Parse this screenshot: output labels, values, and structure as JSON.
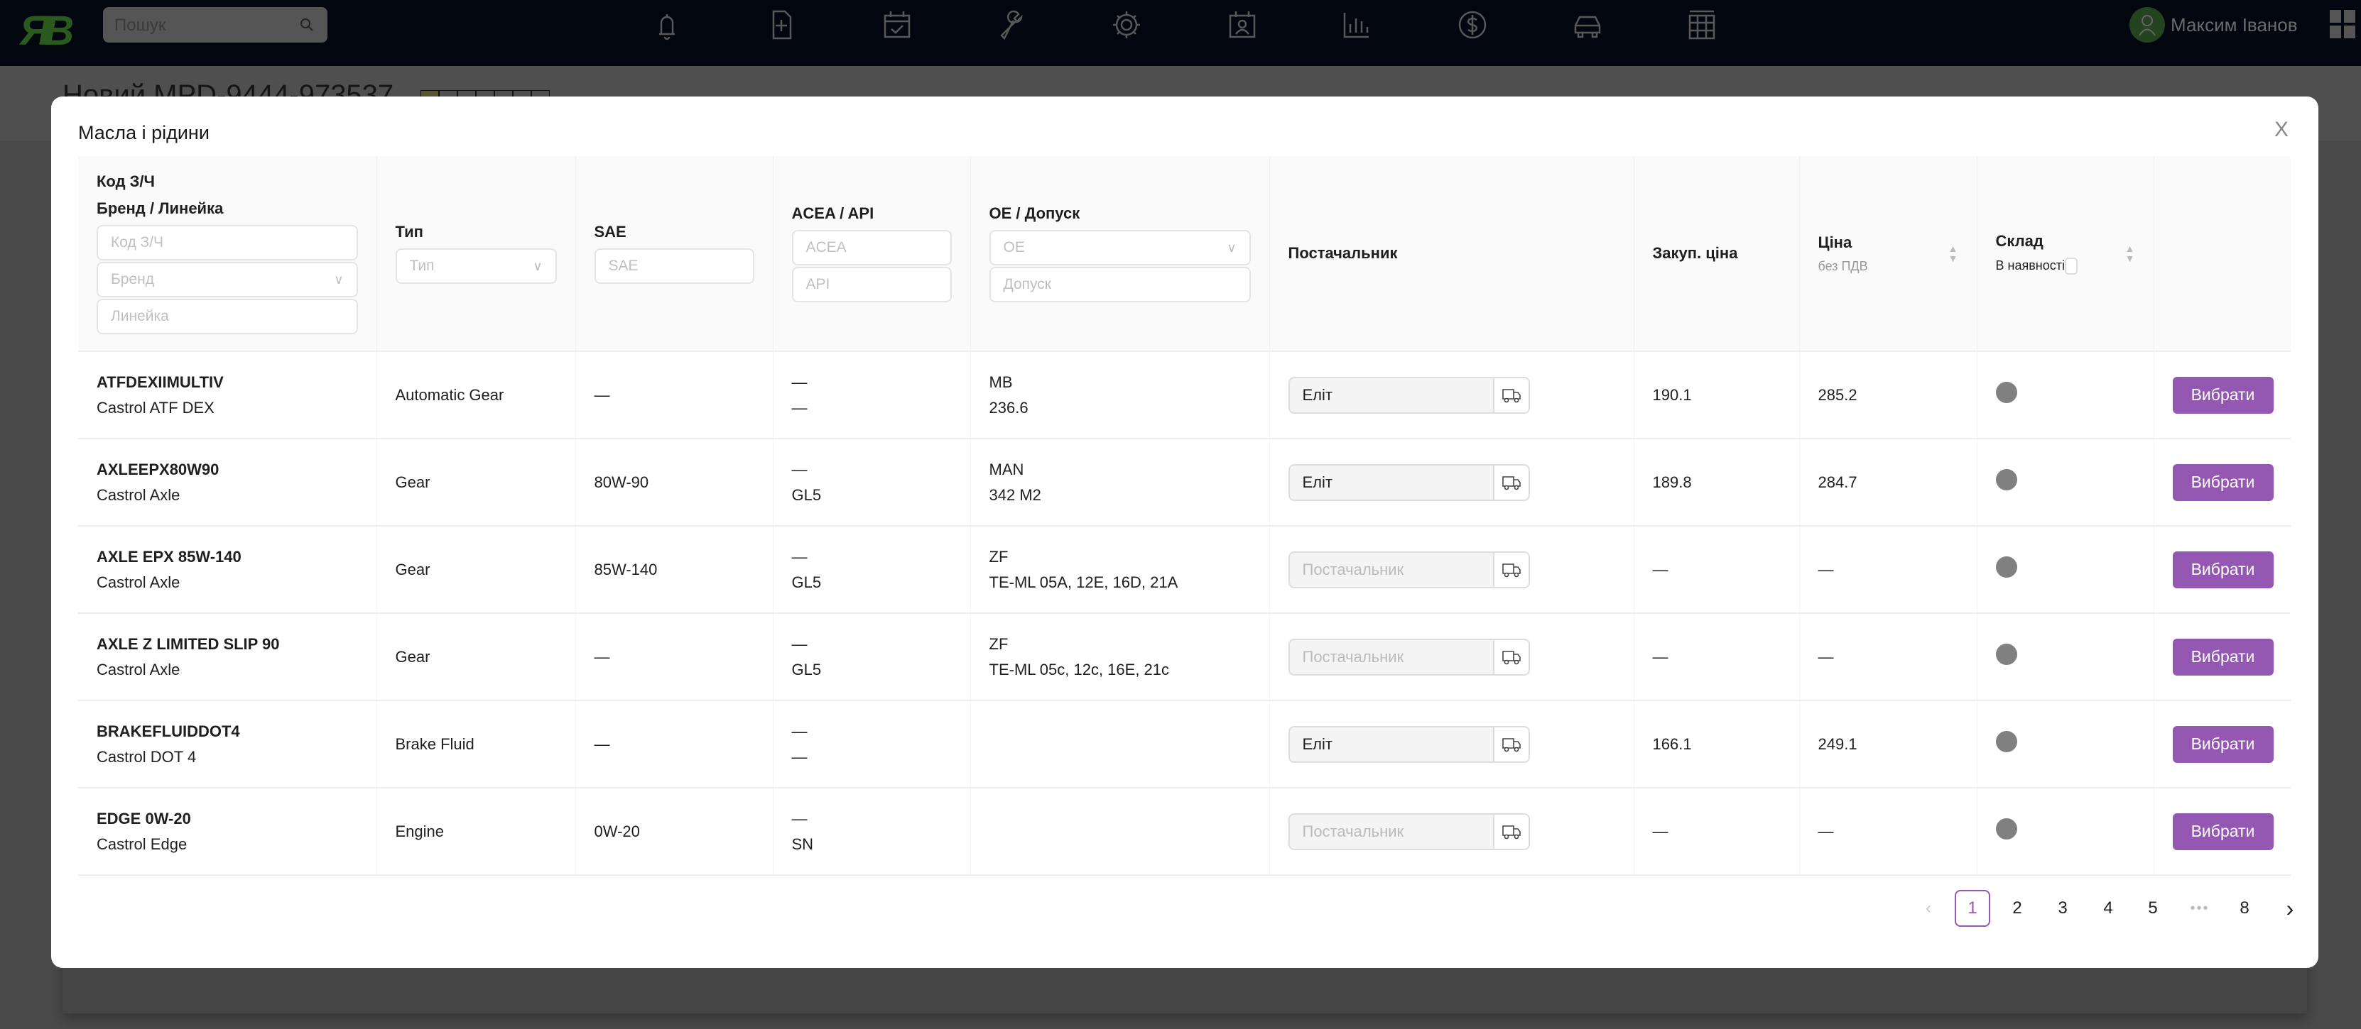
{
  "topbar": {
    "logo": "ЯВ",
    "search_placeholder": "Пошук",
    "nav_icons": [
      "bell-icon",
      "file-plus-icon",
      "calendar-check-icon",
      "wrench-icon",
      "gear-icon",
      "calendar-user-icon",
      "bar-chart-icon",
      "dollar-icon",
      "car-icon",
      "table-icon"
    ],
    "user_name": "Максим Іванов"
  },
  "page": {
    "title": "Новий MPD-9444-973537"
  },
  "modal": {
    "title": "Масла і рідини",
    "close_label": "X",
    "headers": {
      "code": "Код З/Ч",
      "brand_line": "Бренд / Линейка",
      "type": "Тип",
      "sae": "SAE",
      "acea_api": "ACEA / API",
      "oe": "OE / Допуск",
      "supplier": "Постачальник",
      "purchase_price": "Закуп. ціна",
      "price": "Ціна",
      "price_sub": "без ПДВ",
      "stock": "Склад",
      "stock_sub": "В наявності"
    },
    "filters": {
      "code": "Код З/Ч",
      "brand": "Бренд",
      "line": "Линейка",
      "type": "Тип",
      "sae": "SAE",
      "acea": "ACEA",
      "api": "API",
      "oe": "OE",
      "approval": "Допуск"
    },
    "supplier_placeholder": "Постачальник",
    "select_label": "Вибрати",
    "rows": [
      {
        "code": "ATFDEXIIMULTIV",
        "name": "Castrol ATF DEX",
        "type": "Automatic Gear",
        "sae": "—",
        "acea": "—",
        "api": "—",
        "oe": "MB",
        "approval": "236.6",
        "supplier": "Еліт",
        "purchase": "190.1",
        "price": "285.2"
      },
      {
        "code": "AXLEEPX80W90",
        "name": "Castrol Axle",
        "type": "Gear",
        "sae": "80W-90",
        "acea": "—",
        "api": "GL5",
        "oe": "MAN",
        "approval": "342 M2",
        "supplier": "Еліт",
        "purchase": "189.8",
        "price": "284.7"
      },
      {
        "code": "AXLE EPX 85W-140",
        "name": "Castrol Axle",
        "type": "Gear",
        "sae": "85W-140",
        "acea": "—",
        "api": "GL5",
        "oe": "ZF",
        "approval": "TE-ML 05A, 12E, 16D, 21A",
        "supplier": "",
        "purchase": "—",
        "price": "—"
      },
      {
        "code": "AXLE Z LIMITED SLIP 90",
        "name": "Castrol Axle",
        "type": "Gear",
        "sae": "—",
        "acea": "—",
        "api": "GL5",
        "oe": "ZF",
        "approval": "TE-ML 05c, 12c, 16E, 21c",
        "supplier": "",
        "purchase": "—",
        "price": "—"
      },
      {
        "code": "BRAKEFLUIDDOT4",
        "name": "Castrol DOT 4",
        "type": "Brake Fluid",
        "sae": "—",
        "acea": "—",
        "api": "—",
        "oe": "",
        "approval": "",
        "supplier": "Еліт",
        "purchase": "166.1",
        "price": "249.1"
      },
      {
        "code": "EDGE 0W-20",
        "name": "Castrol Edge",
        "type": "Engine",
        "sae": "0W-20",
        "acea": "—",
        "api": "SN",
        "oe": "",
        "approval": "",
        "supplier": "",
        "purchase": "—",
        "price": "—"
      }
    ],
    "pagination": {
      "prev": "‹",
      "pages": [
        "1",
        "2",
        "3",
        "4",
        "5"
      ],
      "ellipsis": "•••",
      "last": "8",
      "next": "›",
      "current": "1"
    }
  },
  "colors": {
    "accent": "#9558b2",
    "topbar": "#02070f",
    "stock_dot": "#808080"
  }
}
